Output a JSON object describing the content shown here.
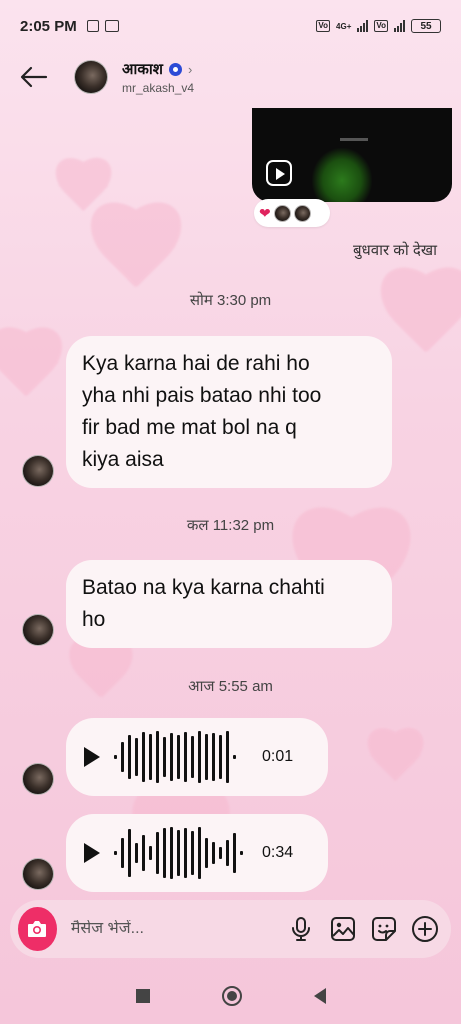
{
  "status_bar": {
    "time": "2:05 PM",
    "battery": "55",
    "network": "4G+"
  },
  "header": {
    "name": "आकाश",
    "handle": "mr_akash_v4",
    "verified": true
  },
  "shared_reel": {
    "reactions": [
      "heart",
      "avatar",
      "avatar"
    ],
    "seen_label": "बुधवार को देखा"
  },
  "messages": [
    {
      "timestamp": "सोम 3:30 pm",
      "lines": [
        "Kya karna hai de rahi ho",
        "yha nhi pais batao nhi too",
        "fir bad me mat bol na q",
        "kiya aisa"
      ]
    },
    {
      "timestamp": "कल 11:32 pm",
      "lines": [
        "Batao na kya karna chahti",
        "ho"
      ]
    }
  ],
  "voice_section": {
    "timestamp": "आज 5:55 am",
    "voice_notes": [
      {
        "duration": "0:01"
      },
      {
        "duration": "0:34"
      }
    ]
  },
  "composer": {
    "placeholder": "मैसेज भेजें..."
  },
  "colors": {
    "accent": "#ee2e67",
    "bubble": "#fcf4f6",
    "background": "#f8d3e3"
  }
}
